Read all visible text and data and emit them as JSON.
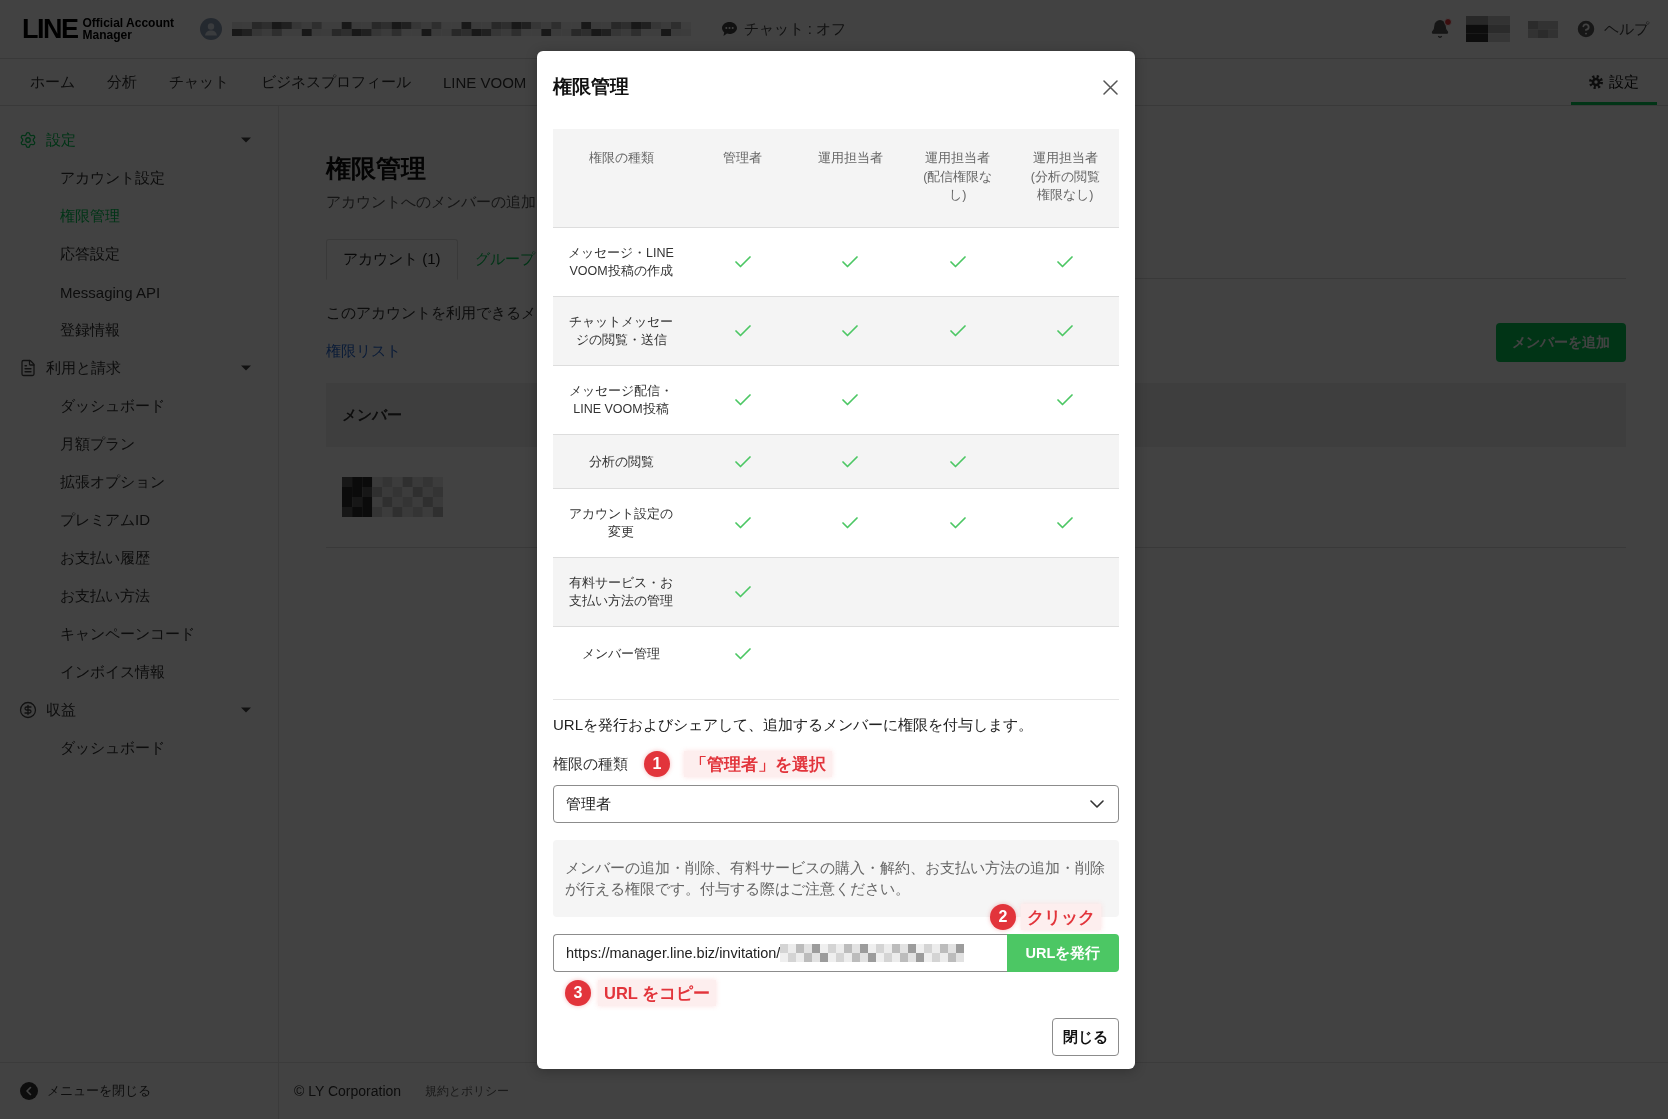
{
  "header": {
    "logo": {
      "wordmark": "LINE",
      "subtitle": "Official Account Manager"
    },
    "chat_status": "チャット : オフ",
    "has_notification": true,
    "help": "ヘルプ"
  },
  "nav": {
    "items": [
      {
        "label": "ホーム",
        "selected": false
      },
      {
        "label": "分析",
        "selected": false
      },
      {
        "label": "チャット",
        "selected": false
      },
      {
        "label": "ビジネスプロフィール",
        "selected": false
      },
      {
        "label": "LINE VOOM",
        "selected": false
      }
    ],
    "settings": {
      "label": "設定",
      "selected": true
    }
  },
  "sidebar": {
    "sections": [
      {
        "kind": "settings",
        "label": "設定",
        "selected": true,
        "expanded": true,
        "children": [
          {
            "label": "アカウント設定",
            "selected": false
          },
          {
            "label": "権限管理",
            "selected": true
          },
          {
            "label": "応答設定",
            "selected": false
          },
          {
            "label": "Messaging API",
            "selected": false
          },
          {
            "label": "登録情報",
            "selected": false
          }
        ]
      },
      {
        "kind": "billing",
        "label": "利用と請求",
        "selected": false,
        "expanded": true,
        "children": [
          {
            "label": "ダッシュボード",
            "selected": false
          },
          {
            "label": "月額プラン",
            "selected": false
          },
          {
            "label": "拡張オプション",
            "selected": false
          },
          {
            "label": "プレミアムID",
            "selected": false
          },
          {
            "label": "お支払い履歴",
            "selected": false
          },
          {
            "label": "お支払い方法",
            "selected": false
          },
          {
            "label": "キャンペーンコード",
            "selected": false
          },
          {
            "label": "インボイス情報",
            "selected": false
          }
        ]
      },
      {
        "kind": "revenue",
        "label": "収益",
        "selected": false,
        "expanded": true,
        "children": [
          {
            "label": "ダッシュボード",
            "selected": false
          }
        ]
      }
    ],
    "collapse_label": "メニューを閉じる"
  },
  "page": {
    "title": "権限管理",
    "subtitle": "アカウントへのメンバーの追加",
    "tabs": [
      {
        "label": "アカウント (1)",
        "selected": true
      },
      {
        "label": "グループ",
        "selected": false
      }
    ],
    "description": "このアカウントを利用できるメ",
    "permission_link": "権限リスト",
    "add_button": "メンバーを追加",
    "member_table": {
      "columns": [
        "メンバー"
      ]
    }
  },
  "footer": {
    "copyright": "© LY Corporation",
    "policy_link": "規約とポリシー"
  },
  "dialog": {
    "title": "権限管理",
    "table": {
      "columns": [
        "権限の種類",
        "管理者",
        "運用担当者",
        "運用担当者(配信権限なし)",
        "運用担当者(分析の閲覧権限なし)"
      ],
      "rows": [
        {
          "label": "メッセージ・LINE VOOM投稿の作成",
          "checks": [
            true,
            true,
            true,
            true
          ]
        },
        {
          "label": "チャットメッセージの閲覧・送信",
          "checks": [
            true,
            true,
            true,
            true
          ]
        },
        {
          "label": "メッセージ配信・LINE VOOM投稿",
          "checks": [
            true,
            true,
            false,
            true
          ]
        },
        {
          "label": "分析の閲覧",
          "checks": [
            true,
            true,
            true,
            false
          ]
        },
        {
          "label": "アカウント設定の変更",
          "checks": [
            true,
            true,
            true,
            true
          ]
        },
        {
          "label": "有料サービス・お支払い方法の管理",
          "checks": [
            true,
            false,
            false,
            false
          ]
        },
        {
          "label": "メンバー管理",
          "checks": [
            true,
            false,
            false,
            false
          ]
        }
      ]
    },
    "intro": "URLを発行およびシェアして、追加するメンバーに権限を付与します。",
    "role_label": "権限の種類",
    "role_annotation": {
      "number": "1",
      "text": "「管理者」を選択"
    },
    "role_select": {
      "value": "管理者"
    },
    "note": "メンバーの追加・削除、有料サービスの購入・解約、お支払い方法の追加・削除が行える権限です。付与する際はご注意ください。",
    "issue_annotation": {
      "number": "2",
      "text": "クリック"
    },
    "url_field": {
      "value": "https://manager.line.biz/invitation/"
    },
    "issue_button": "URLを発行",
    "copy_annotation": {
      "number": "3",
      "text": "URL をコピー"
    },
    "close_button": "閉じる"
  }
}
